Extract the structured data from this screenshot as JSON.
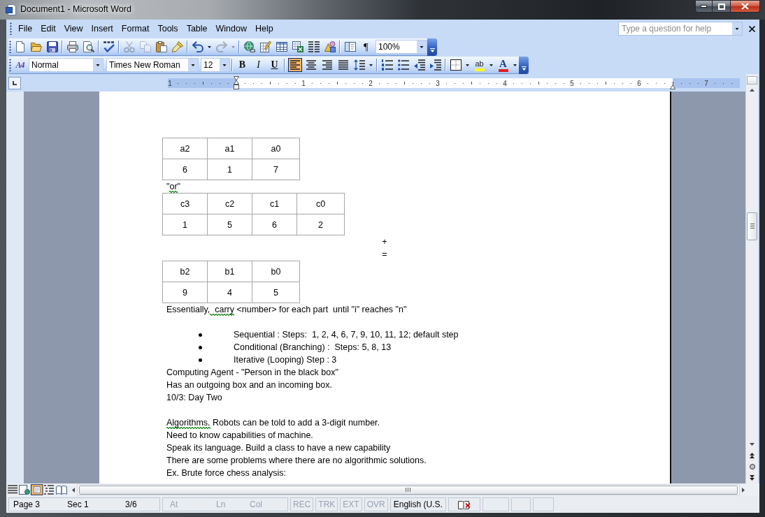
{
  "window": {
    "title": "Document1 - Microsoft Word"
  },
  "menu_bar": {
    "items": [
      "File",
      "Edit",
      "View",
      "Insert",
      "Format",
      "Tools",
      "Table",
      "Window",
      "Help"
    ],
    "help_box": {
      "placeholder": "Type a question for help"
    }
  },
  "standard_toolbar": {
    "buttons": [
      {
        "disabled": false
      },
      {
        "disabled": false
      },
      {
        "disabled": false
      },
      {
        "disabled": false
      },
      {
        "disabled": false
      },
      {
        "disabled": false
      },
      {
        "disabled": true
      },
      {
        "disabled": true
      },
      {
        "disabled": false
      },
      {
        "disabled": false
      },
      {
        "disabled": false
      },
      {
        "disabled": false
      },
      {
        "disabled": true
      },
      {
        "disabled": true
      },
      {
        "disabled": false
      },
      {
        "disabled": false
      },
      {
        "disabled": false
      },
      {
        "disabled": false
      },
      {
        "disabled": false
      },
      {
        "disabled": false
      },
      {
        "disabled": false
      },
      {
        "label": "¶",
        "disabled": false
      }
    ],
    "zoom": "100%"
  },
  "formatting_toolbar": {
    "styles_button": {
      "label": "A4"
    },
    "style": "Normal",
    "font": "Times New Roman",
    "size": "12",
    "format_buttons": [
      {
        "label": "B",
        "on": false
      },
      {
        "label": "I",
        "on": false
      },
      {
        "label": "U",
        "on": false
      }
    ],
    "alignment_buttons": [
      {
        "selected": true
      },
      {
        "selected": false
      },
      {
        "selected": false
      },
      {
        "selected": false
      }
    ],
    "highlight_button": {
      "label": "ab"
    },
    "font_color_button": {
      "label": "A"
    }
  },
  "ruler": {
    "labels": [
      "1",
      "1",
      "2",
      "3",
      "4",
      "5",
      "6",
      "7"
    ]
  },
  "document": {
    "blocks": [
      {
        "kind": "table",
        "rows": [
          [
            "a2",
            "a1",
            "a0"
          ],
          [
            "6",
            "1",
            "7"
          ]
        ]
      },
      {
        "kind": "paragraph",
        "runs": [
          {
            "text": "\"",
            "grammar_flag": false
          },
          {
            "text": "or",
            "grammar_flag": true
          },
          {
            "text": "\"",
            "grammar_flag": false
          }
        ]
      },
      {
        "kind": "table",
        "rows": [
          [
            "c3",
            "c2",
            "c1",
            "c0"
          ],
          [
            "1",
            "5",
            "6",
            "2"
          ]
        ]
      },
      {
        "kind": "centered",
        "text": "+"
      },
      {
        "kind": "centered",
        "text": "="
      },
      {
        "kind": "table",
        "rows": [
          [
            "b2",
            "b1",
            "b0"
          ],
          [
            "9",
            "4",
            "5"
          ]
        ]
      },
      {
        "kind": "paragraph",
        "runs": [
          {
            "text": "Essentially,",
            "grammar_flag": false
          },
          {
            "text": "  carry",
            "grammar_flag": true
          },
          {
            "text": " <number> for each part  until \"i\" reaches \"n\"",
            "grammar_flag": false
          }
        ]
      },
      {
        "kind": "blank"
      },
      {
        "kind": "bullet",
        "text": "Sequential : Steps:  1, 2, 4, 6, 7, 9, 10, 11, 12; default step"
      },
      {
        "kind": "bullet",
        "text": "Conditional (Branching) :  Steps: 5, 8, 13"
      },
      {
        "kind": "bullet",
        "text": "Iterative (Looping) Step : 3"
      },
      {
        "kind": "paragraph",
        "text": "Computing Agent - \"Person in the black box\""
      },
      {
        "kind": "paragraph",
        "text": "Has an outgoing box and an incoming box."
      },
      {
        "kind": "paragraph",
        "text": "10/3: Day Two"
      },
      {
        "kind": "blank"
      },
      {
        "kind": "paragraph",
        "runs": [
          {
            "text": "Algorithms.",
            "grammar_flag": true
          },
          {
            "text": " Robots can be told to add a 3-digit number.",
            "grammar_flag": false
          }
        ]
      },
      {
        "kind": "paragraph",
        "text": "Need to know capabilities of machine."
      },
      {
        "kind": "paragraph",
        "text": "Speak its language. Build a class to have a new capability"
      },
      {
        "kind": "paragraph",
        "text": "There are some problems where there are no algorithmic solutions."
      },
      {
        "kind": "paragraph",
        "text": "Ex. Brute force chess analysis:"
      }
    ]
  },
  "view_buttons": [
    {
      "selected": false
    },
    {
      "selected": false
    },
    {
      "selected": true
    },
    {
      "selected": false
    },
    {
      "selected": false
    }
  ],
  "status_bar": {
    "position": [
      "Page 3",
      "Sec 1",
      "3/6"
    ],
    "cursor": [
      {
        "label": "At",
        "disabled": true
      },
      {
        "label": "Ln",
        "disabled": true
      },
      {
        "label": "Col",
        "disabled": true
      }
    ],
    "modes": [
      {
        "label": "REC",
        "active": false
      },
      {
        "label": "TRK",
        "active": false
      },
      {
        "label": "EXT",
        "active": false
      },
      {
        "label": "OVR",
        "active": false
      }
    ],
    "language": "English (U.S."
  }
}
